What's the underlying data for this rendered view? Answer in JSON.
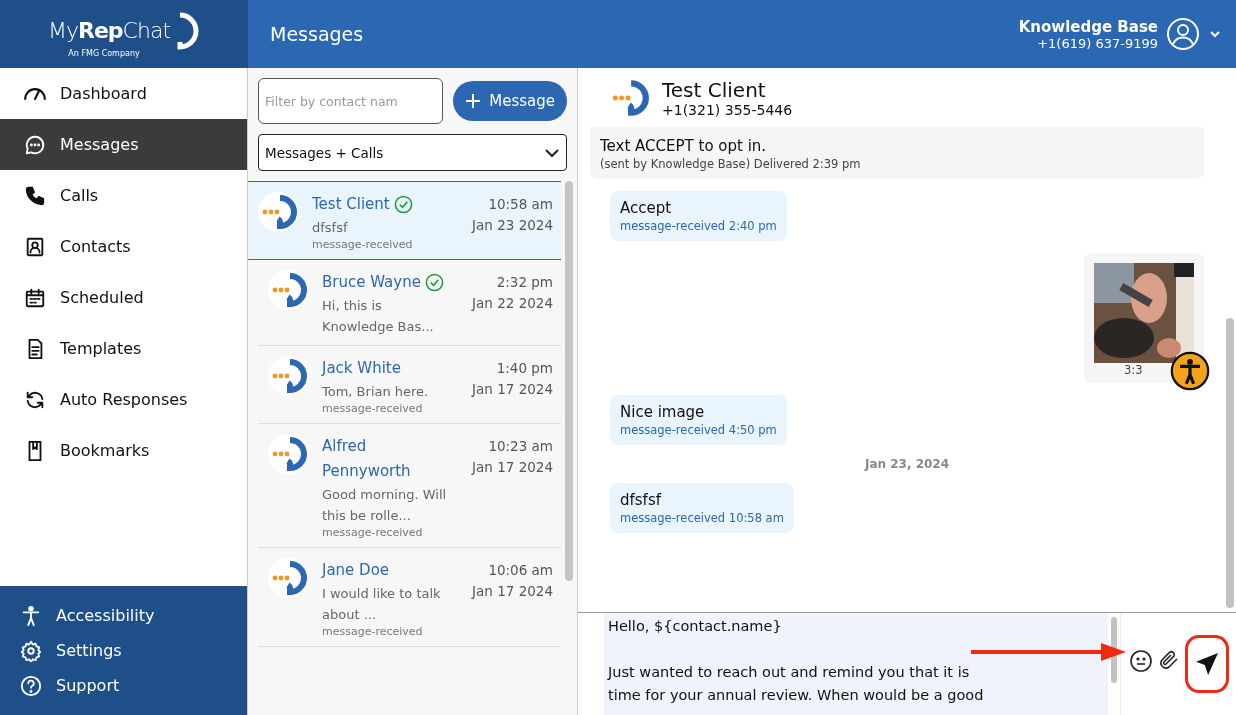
{
  "logo": {
    "wordmark": "My**Rep**Chat",
    "tagline": "An FMG Company"
  },
  "header": {
    "title": "Messages",
    "user_name": "Knowledge Base",
    "user_phone": "+1(619) 637-9199"
  },
  "nav": [
    {
      "label": "Dashboard",
      "selected": false
    },
    {
      "label": "Messages",
      "selected": true
    },
    {
      "label": "Calls",
      "selected": false
    },
    {
      "label": "Contacts",
      "selected": false
    },
    {
      "label": "Scheduled",
      "selected": false
    },
    {
      "label": "Templates",
      "selected": false
    },
    {
      "label": "Auto Responses",
      "selected": false
    },
    {
      "label": "Bookmarks",
      "selected": false
    }
  ],
  "nav_footer": [
    "Accessibility",
    "Settings",
    "Support"
  ],
  "contact_panel": {
    "filter_placeholder": "Filter by contact nam",
    "new_button": "Message",
    "view_select": "Messages + Calls",
    "contacts": [
      {
        "name": "Test Client",
        "preview": "dfsfsf",
        "status": "message-received",
        "time": "10:58 am",
        "date": "Jan 23 2024",
        "verified": true,
        "selected": true
      },
      {
        "name": "Bruce Wayne",
        "preview": "Hi, this is Knowledge Bas...",
        "time": "2:32 pm",
        "date": "Jan 22 2024",
        "verified": true,
        "selected": false
      },
      {
        "name": "Jack White",
        "preview": "Tom, Brian here.",
        "status": "message-received",
        "time": "1:40 pm",
        "date": "Jan 17 2024",
        "verified": false,
        "selected": false
      },
      {
        "name": "Alfred Pennyworth",
        "preview": "Good morning. Will this be rolle...",
        "status": "message-received",
        "time": "10:23 am",
        "date": "Jan 17 2024",
        "verified": false,
        "selected": false
      },
      {
        "name": "Jane Doe",
        "preview": "I would like to talk about ...",
        "status": "message-received",
        "time": "10:06 am",
        "date": "Jan 17 2024",
        "verified": false,
        "selected": false
      }
    ]
  },
  "chat": {
    "contact_name": "Test Client",
    "contact_phone": "+1(321) 355-5446",
    "messages": [
      {
        "kind": "sent",
        "text": "Text ACCEPT to opt in.",
        "meta": "(sent by Knowledge Base) Delivered 2:39 pm"
      },
      {
        "kind": "received",
        "text": "Accept",
        "meta": "message-received 2:40 pm"
      },
      {
        "meta": "3:3"
      },
      {
        "kind": "received",
        "text": "Nice image",
        "meta": "message-received 4:50 pm"
      },
      {
        "kind": "date",
        "text": "Jan 23, 2024"
      },
      {
        "kind": "received",
        "text": "dfsfsf",
        "meta": "message-received 10:58 am"
      }
    ],
    "composer": [
      [
        "Hello, ${contact.name}"
      ],
      [
        "Just wanted to reach out and remind you that it is",
        "time for your annual review. When would be a good"
      ]
    ]
  }
}
